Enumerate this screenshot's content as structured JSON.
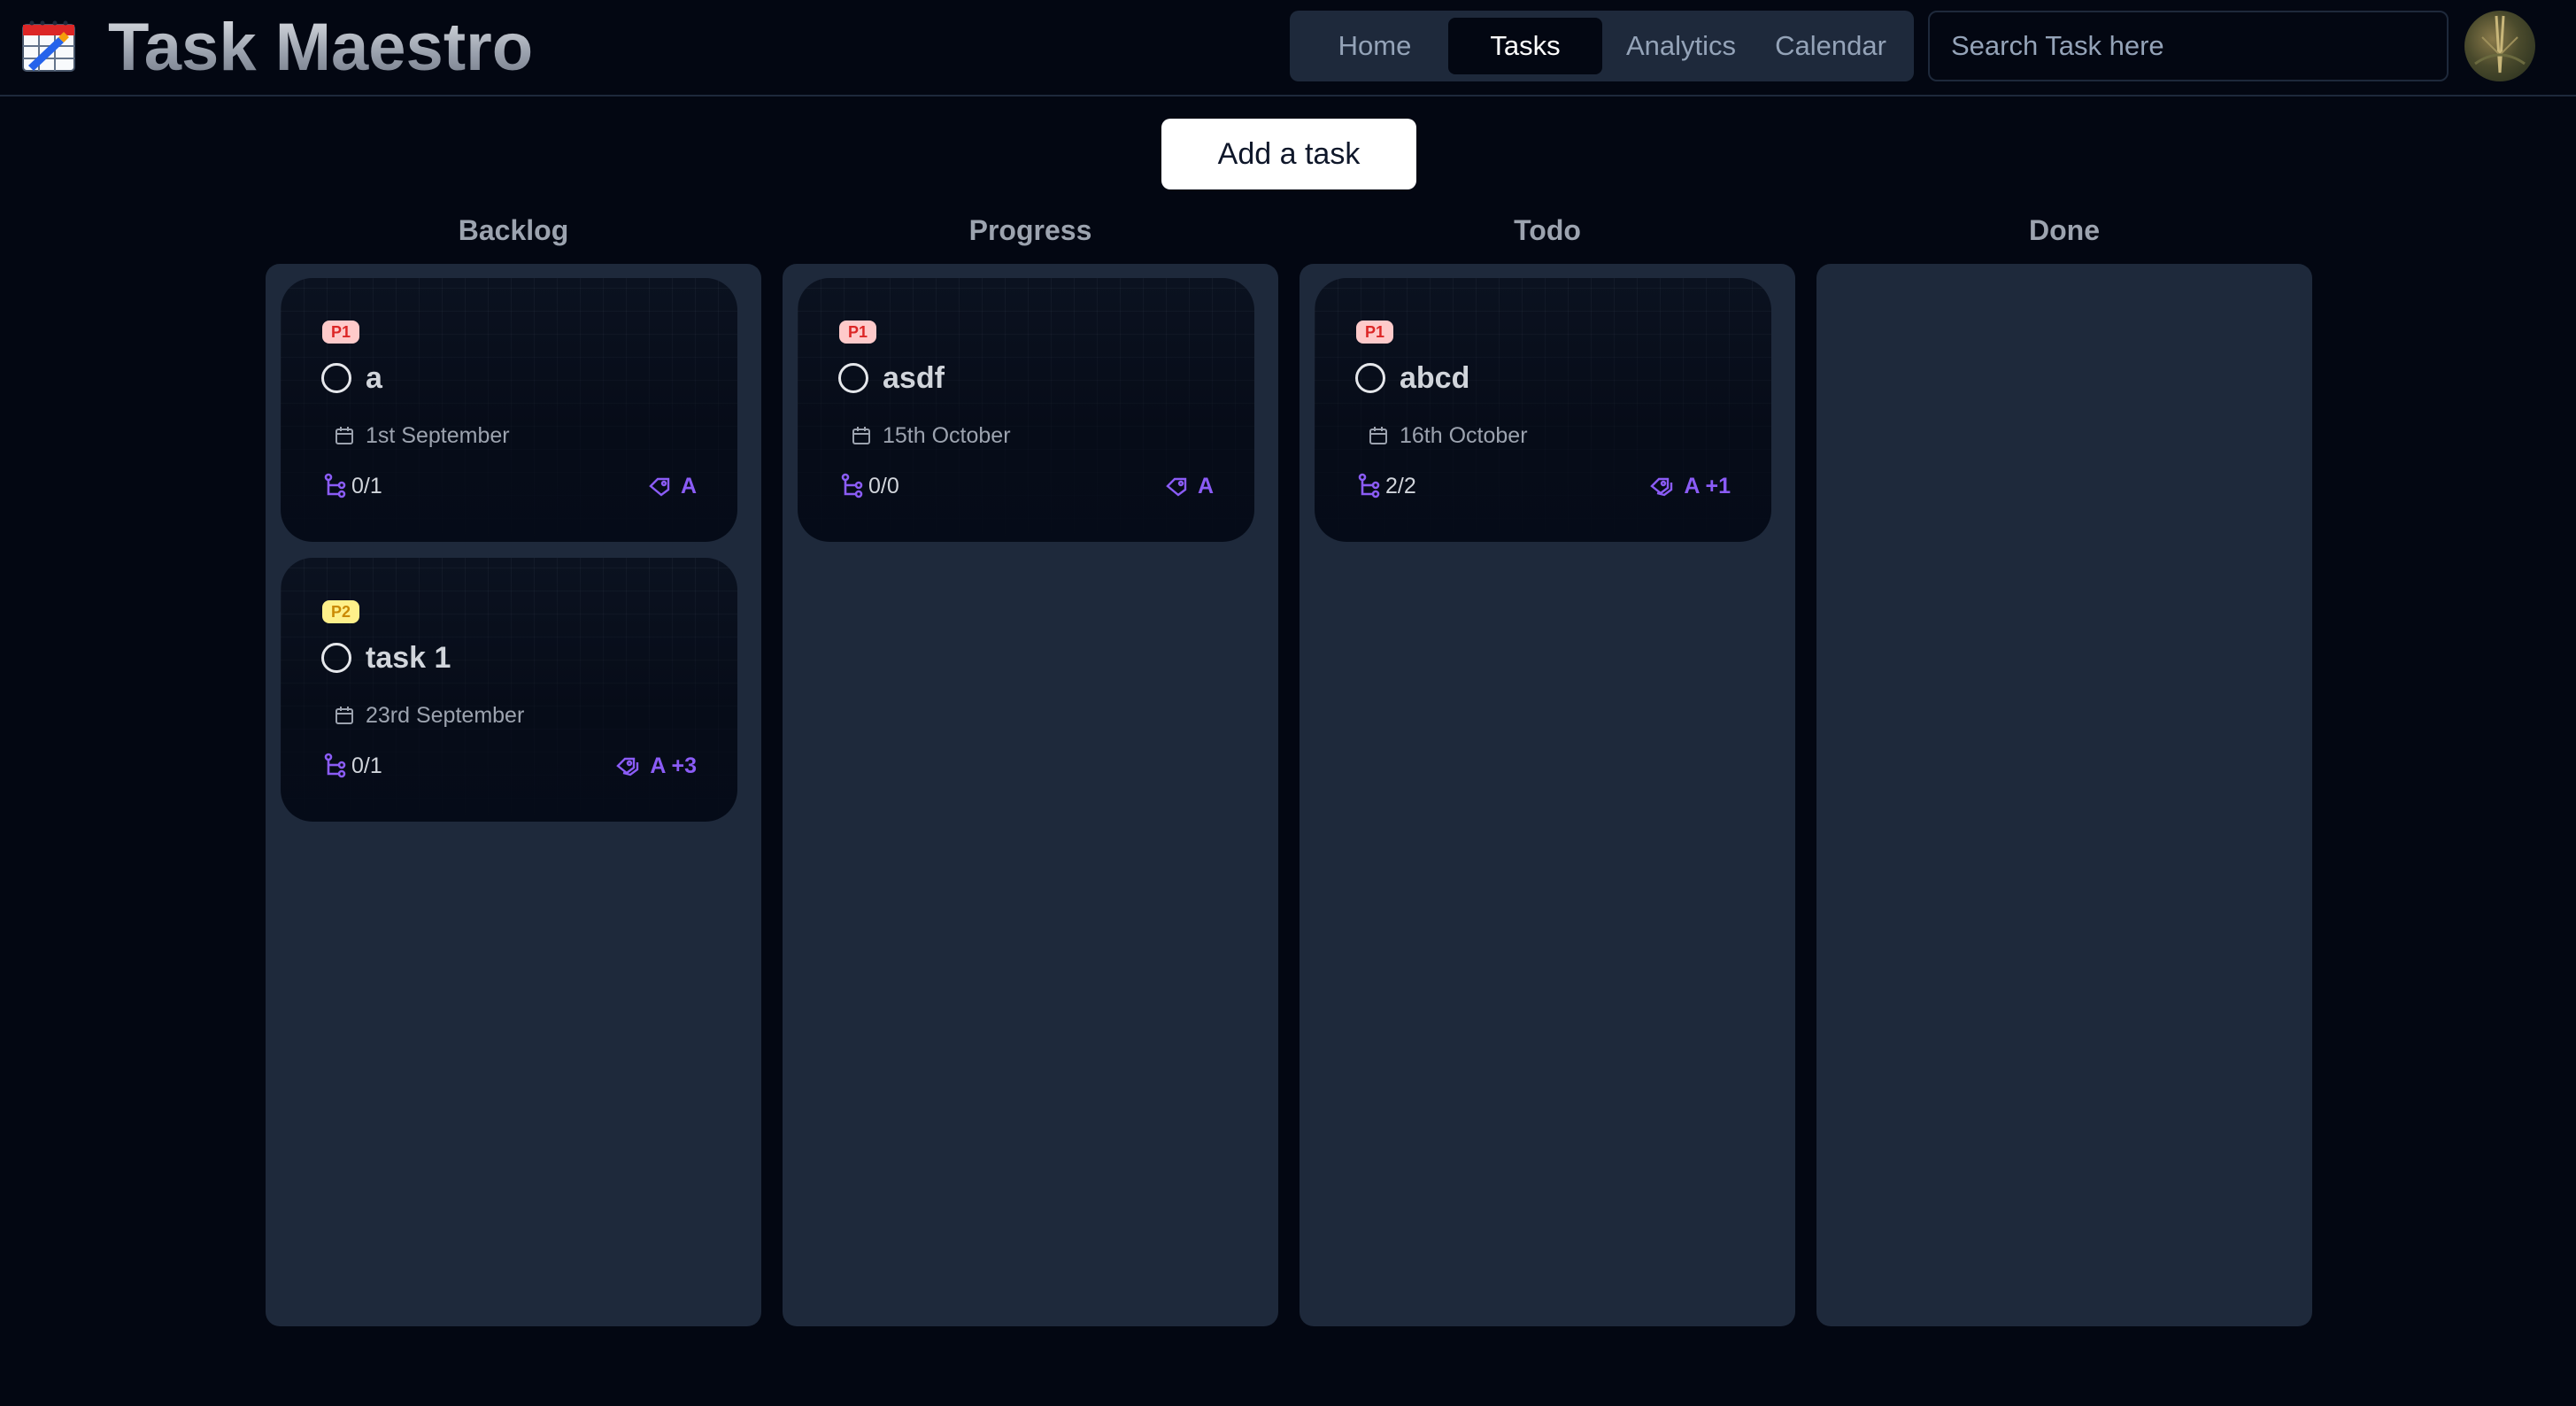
{
  "header": {
    "title": "Task Maestro",
    "logo_icon": "calendar-logo-icon",
    "nav": [
      {
        "label": "Home",
        "active": false
      },
      {
        "label": "Tasks",
        "active": true
      },
      {
        "label": "Analytics",
        "active": false
      },
      {
        "label": "Calendar",
        "active": false
      }
    ],
    "search_placeholder": "Search Task here",
    "avatar_icon": "user-avatar"
  },
  "add_task_label": "Add a task",
  "columns": [
    {
      "title": "Backlog",
      "cards": [
        {
          "priority": "P1",
          "title": "a",
          "date": "1st September",
          "subtasks": "0/1",
          "tags": "A"
        },
        {
          "priority": "P2",
          "title": "task 1",
          "date": "23rd September",
          "subtasks": "0/1",
          "tags": "A +3"
        }
      ]
    },
    {
      "title": "Progress",
      "cards": [
        {
          "priority": "P1",
          "title": "asdf",
          "date": "15th October",
          "subtasks": "0/0",
          "tags": "A"
        }
      ]
    },
    {
      "title": "Todo",
      "cards": [
        {
          "priority": "P1",
          "title": "abcd",
          "date": "16th October",
          "subtasks": "2/2",
          "tags": "A +1"
        }
      ]
    },
    {
      "title": "Done",
      "cards": []
    }
  ],
  "colors": {
    "background": "#030712",
    "column": "#1e293b",
    "accent_tag": "#8b5cf6",
    "p1_badge_bg": "#fecaca",
    "p1_badge_text": "#dc2626",
    "p2_badge_bg": "#fef08a",
    "p2_badge_text": "#ca8a04"
  }
}
